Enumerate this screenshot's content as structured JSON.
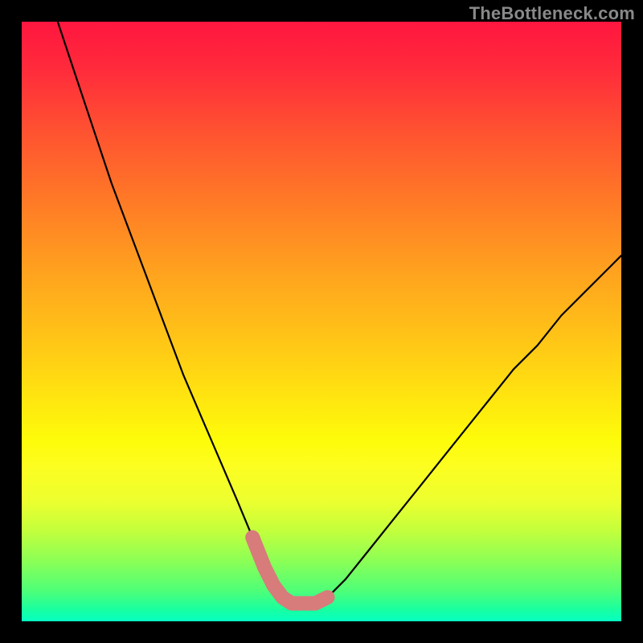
{
  "watermark": "TheBottleneck.com",
  "chart_data": {
    "type": "line",
    "title": "",
    "xlabel": "",
    "ylabel": "",
    "xlim": [
      0,
      100
    ],
    "ylim": [
      0,
      100
    ],
    "grid": false,
    "series": [
      {
        "name": "bottleneck-curve",
        "x": [
          6,
          9,
          12,
          15,
          18,
          21,
          24,
          27,
          30,
          33,
          36,
          38.5,
          40.5,
          42,
          43.5,
          45,
          49,
          51,
          54,
          58,
          62,
          66,
          70,
          74,
          78,
          82,
          86,
          90,
          94,
          98,
          100
        ],
        "y": [
          100,
          91,
          82,
          73,
          65,
          57,
          49,
          41,
          34,
          27,
          20,
          14,
          9,
          6,
          4,
          3,
          3,
          4,
          7,
          12,
          17,
          22,
          27,
          32,
          37,
          42,
          46,
          51,
          55,
          59,
          61
        ]
      },
      {
        "name": "highlight-segment",
        "x": [
          38.5,
          40.5,
          42,
          43.5,
          45,
          49,
          51
        ],
        "y": [
          14,
          9,
          6,
          4,
          3,
          3,
          4
        ]
      }
    ],
    "annotations": [],
    "background": {
      "type": "vertical-gradient",
      "stops": [
        {
          "pos": 0.0,
          "color": "#ff163f"
        },
        {
          "pos": 0.3,
          "color": "#ff7a26"
        },
        {
          "pos": 0.63,
          "color": "#ffe60f"
        },
        {
          "pos": 0.85,
          "color": "#c2ff3d"
        },
        {
          "pos": 1.0,
          "color": "#06ffc2"
        }
      ]
    }
  }
}
